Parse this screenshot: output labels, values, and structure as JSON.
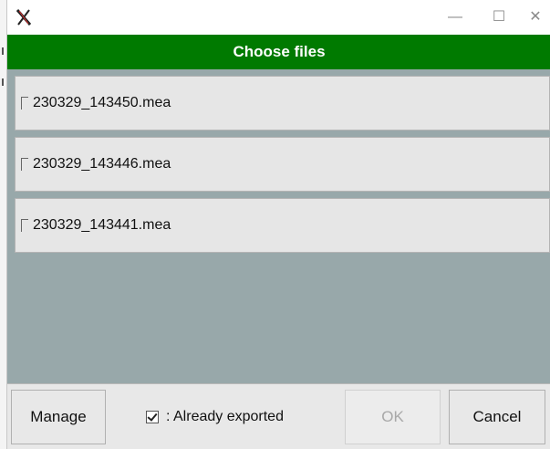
{
  "window": {
    "app_icon": "x-app-icon",
    "controls": {
      "minimize": "—",
      "maximize": "☐",
      "close": "✕"
    }
  },
  "header": {
    "title": "Choose files"
  },
  "files": [
    {
      "name": "230329_143450.mea",
      "checked": false
    },
    {
      "name": "230329_143446.mea",
      "checked": false
    },
    {
      "name": "230329_143441.mea",
      "checked": false
    }
  ],
  "footer": {
    "manage_label": "Manage",
    "legend_label": ": Already exported",
    "ok_label": "OK",
    "cancel_label": "Cancel"
  },
  "colors": {
    "header_bg": "#007a00",
    "content_bg": "#98a8aa",
    "row_bg": "#e6e6e6"
  }
}
